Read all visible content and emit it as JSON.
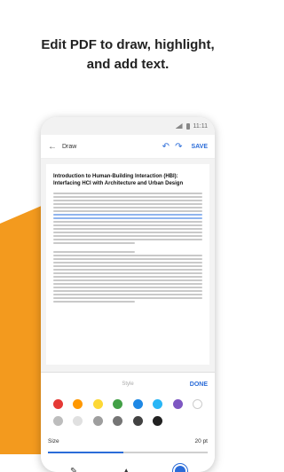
{
  "promo": {
    "line1": "Edit PDF to draw, highlight,",
    "line2": "and add text."
  },
  "status": {
    "time": "11:11"
  },
  "toolbar": {
    "title": "Draw",
    "save": "SAVE",
    "undo_icon": "undo-icon",
    "redo_icon": "redo-icon",
    "back_icon": "back-arrow-icon"
  },
  "document": {
    "title_line1": "Introduction to Human-Building Interaction (HBI):",
    "title_line2": "Interfacing HCI with Architecture and Urban Design"
  },
  "panel": {
    "style_label": "Style",
    "done": "DONE",
    "size_label": "Size",
    "size_value": "20 pt",
    "size_fraction": 0.47
  },
  "colors": {
    "accent": "#2b6cd8",
    "orange": "#f39a1e",
    "palette": [
      "#e53935",
      "#ff9800",
      "#fdd835",
      "#43a047",
      "#1e88e5",
      "#29b6f6",
      "#7e57c2",
      "#ffffff",
      "#bdbdbd",
      "#e0e0e0",
      "#9e9e9e",
      "#757575",
      "#424242",
      "#212121"
    ]
  },
  "tools": [
    "pen-icon",
    "highlighter-icon",
    "color-circle-icon"
  ]
}
